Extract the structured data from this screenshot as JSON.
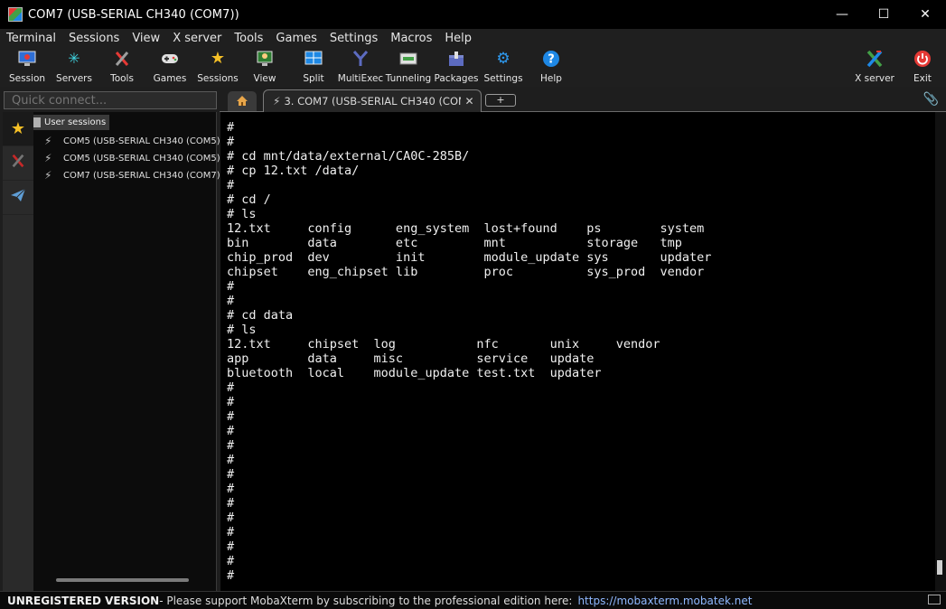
{
  "window": {
    "title": "COM7  (USB-SERIAL CH340 (COM7))",
    "minimize": "—",
    "maximize": "☐",
    "close": "✕"
  },
  "menu": [
    "Terminal",
    "Sessions",
    "View",
    "X server",
    "Tools",
    "Games",
    "Settings",
    "Macros",
    "Help"
  ],
  "toolbar": {
    "session": "Session",
    "servers": "Servers",
    "tools": "Tools",
    "games": "Games",
    "sessions": "Sessions",
    "view": "View",
    "split": "Split",
    "multiexec": "MultiExec",
    "tunneling": "Tunneling",
    "packages": "Packages",
    "settings": "Settings",
    "help": "Help",
    "xserver": "X server",
    "exit": "Exit"
  },
  "quick_connect": {
    "placeholder": "Quick connect..."
  },
  "tabs": {
    "session_tab": "3. COM7  (USB-SERIAL CH340 (COM7))",
    "close": "✕",
    "new_tab": "+"
  },
  "sessions": {
    "root": "User sessions",
    "items": [
      "COM5  (USB-SERIAL CH340 (COM5))",
      "COM5  (USB-SERIAL CH340 (COM5))",
      "COM7  (USB-SERIAL CH340 (COM7))"
    ]
  },
  "terminal": {
    "lines": [
      "#",
      "#",
      "# cd mnt/data/external/CA0C-285B/",
      "# cp 12.txt /data/",
      "#",
      "# cd /",
      "# ls",
      "12.txt     config      eng_system  lost+found    ps        system",
      "bin        data        etc         mnt           storage   tmp",
      "chip_prod  dev         init        module_update sys       updater",
      "chipset    eng_chipset lib         proc          sys_prod  vendor",
      "#",
      "#",
      "# cd data",
      "# ls",
      "12.txt     chipset  log           nfc       unix     vendor",
      "app        data     misc          service   update",
      "bluetooth  local    module_update test.txt  updater",
      "#",
      "#",
      "#",
      "#",
      "#",
      "#",
      "#",
      "#",
      "#",
      "#",
      "#",
      "#",
      "#",
      "#"
    ]
  },
  "status": {
    "unregistered": "UNREGISTERED VERSION",
    "message": "  -  Please support MobaXterm by subscribing to the professional edition here:",
    "link": "https://mobaxterm.mobatek.net"
  }
}
